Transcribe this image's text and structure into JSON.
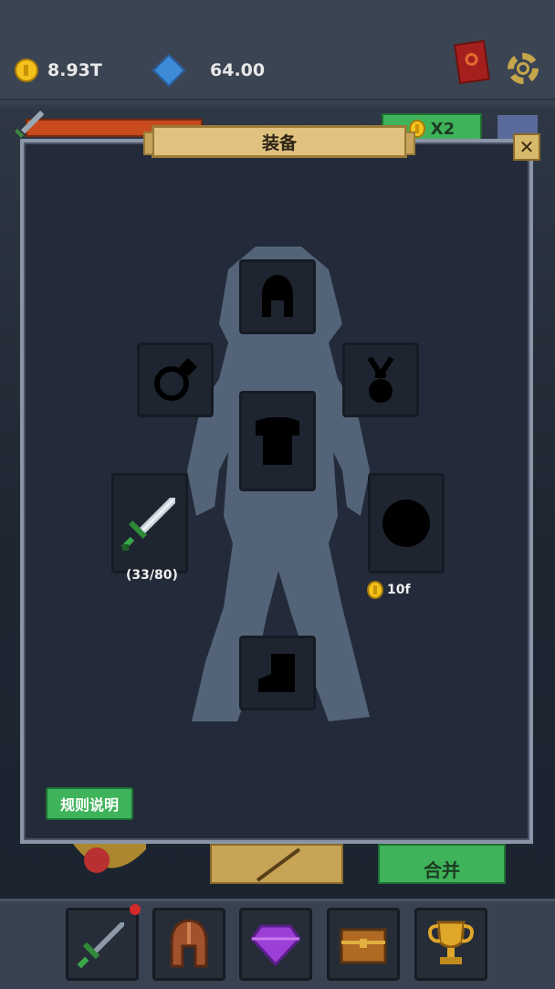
{
  "currencies": {
    "gold": {
      "value": "8.93T",
      "icon": "gold-coin-icon",
      "color": "#f4c21c"
    },
    "gems": {
      "value": "64.00",
      "icon": "blue-gem-icon",
      "color": "#3d8ad6"
    }
  },
  "modal": {
    "title": "装备",
    "close_icon": "close-icon",
    "rules_button": "规则说明"
  },
  "slots": [
    {
      "id": "helmet",
      "icon": "helmet-icon",
      "locked": true
    },
    {
      "id": "ring",
      "icon": "ring-icon",
      "locked": true
    },
    {
      "id": "amulet",
      "icon": "amulet-icon",
      "locked": true
    },
    {
      "id": "armor",
      "icon": "armor-icon",
      "locked": true
    },
    {
      "id": "weapon",
      "icon": "sword-icon",
      "locked": false,
      "label": "(33/80)"
    },
    {
      "id": "shield",
      "icon": "shield-icon",
      "locked": true,
      "price": "10f"
    },
    {
      "id": "boots",
      "icon": "boots-icon",
      "locked": true
    }
  ],
  "background_hud": {
    "multiplier": "X2",
    "partial_button": "合并"
  },
  "bottom_nav": [
    {
      "id": "weapons",
      "icon": "sword-icon",
      "notification": true
    },
    {
      "id": "armor",
      "icon": "helmet-icon"
    },
    {
      "id": "gems",
      "icon": "purple-gem-icon"
    },
    {
      "id": "chest",
      "icon": "treasure-chest-icon"
    },
    {
      "id": "trophy",
      "icon": "trophy-icon"
    }
  ]
}
